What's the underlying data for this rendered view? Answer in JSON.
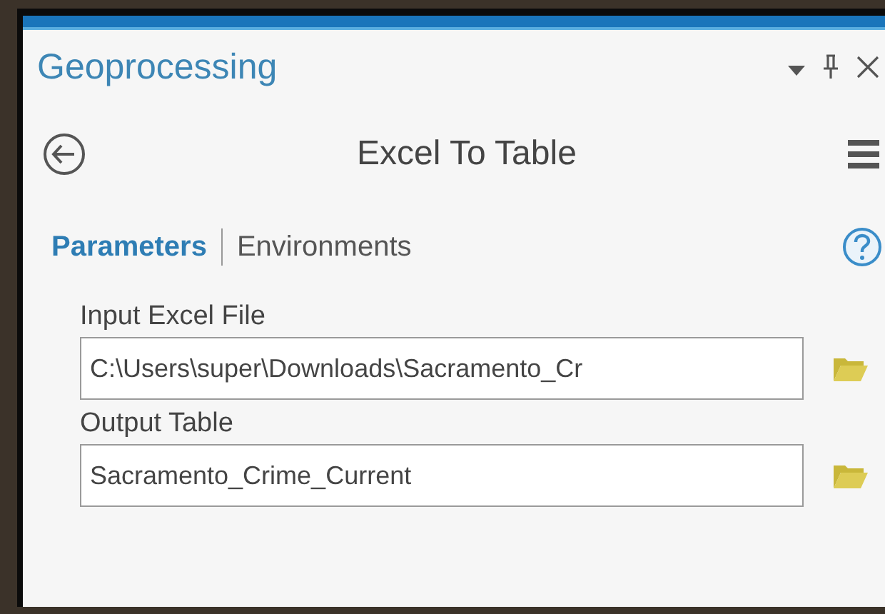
{
  "pane": {
    "title": "Geoprocessing"
  },
  "tool": {
    "title": "Excel To Table"
  },
  "tabs": [
    {
      "label": "Parameters",
      "selected": true
    },
    {
      "label": "Environments",
      "selected": false
    }
  ],
  "parameters": [
    {
      "label": "Input Excel File",
      "value": "C:\\Users\\super\\Downloads\\Sacramento_Cr"
    },
    {
      "label": "Output Table",
      "value": "Sacramento_Crime_Current"
    }
  ]
}
